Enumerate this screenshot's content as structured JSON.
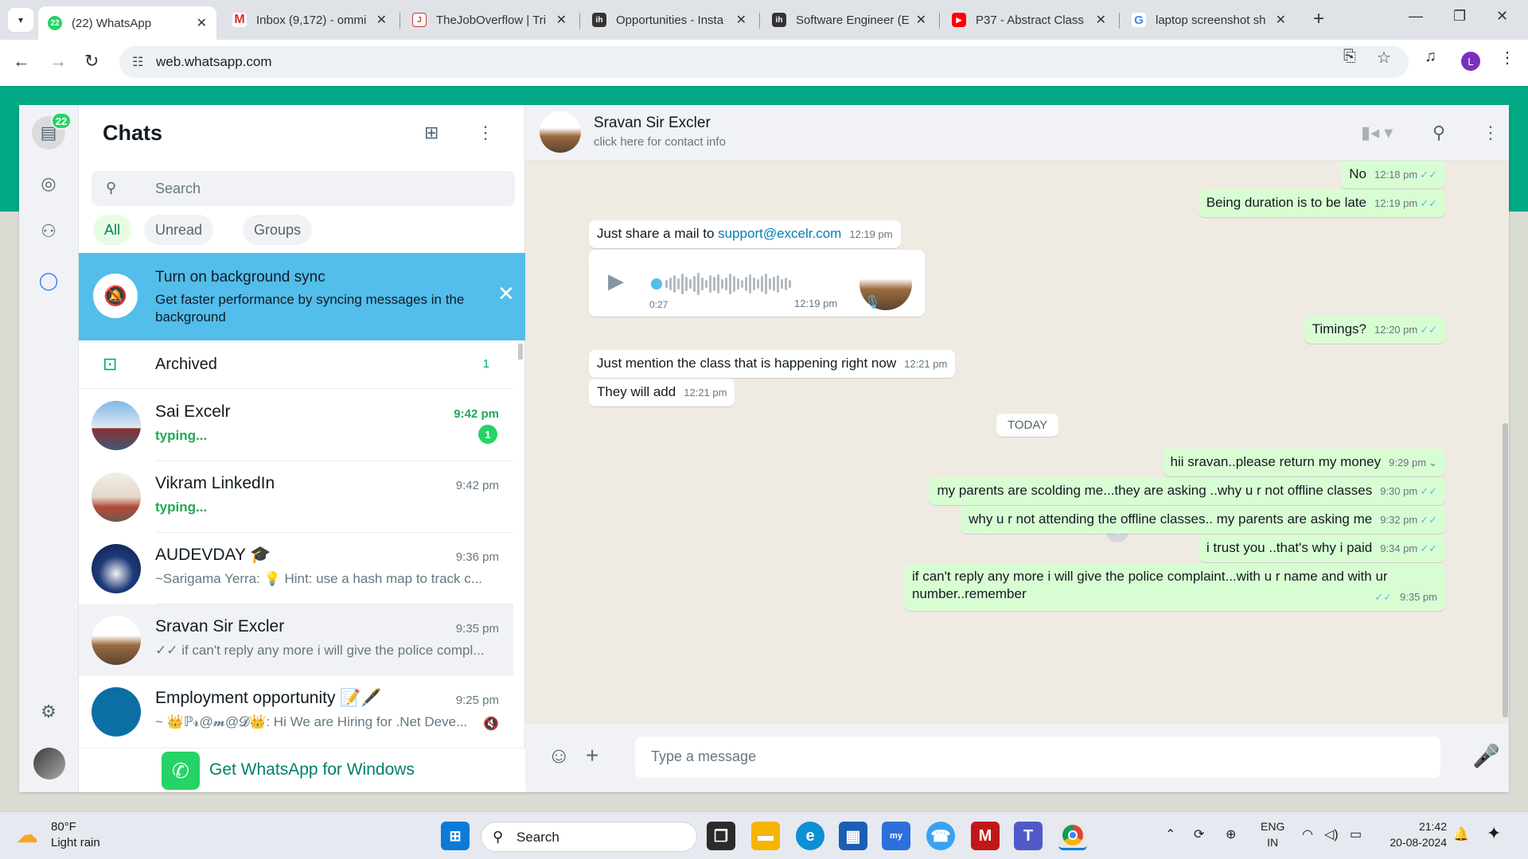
{
  "browser": {
    "tabs": [
      {
        "title": "(22) WhatsApp",
        "favicon": "whatsapp-icon",
        "active": true
      },
      {
        "title": "Inbox (9,172) - ommi",
        "favicon": "gmail-icon"
      },
      {
        "title": "TheJobOverflow | Tri",
        "favicon": "jobs-icon"
      },
      {
        "title": "Opportunities - Insta",
        "favicon": "ih-icon"
      },
      {
        "title": "Software Engineer (E",
        "favicon": "ih-icon"
      },
      {
        "title": "P37 - Abstract Class",
        "favicon": "youtube-icon"
      },
      {
        "title": "laptop screenshot sh",
        "favicon": "google-icon"
      }
    ],
    "url": "web.whatsapp.com",
    "profile_initial": "L"
  },
  "rail": {
    "chats_badge": "22"
  },
  "sidebar": {
    "title": "Chats",
    "search_placeholder": "Search",
    "filters": [
      "All",
      "Unread",
      "Groups"
    ],
    "banner": {
      "title": "Turn on background sync",
      "subtitle": "Get faster performance by syncing messages in the background"
    },
    "archived": {
      "label": "Archived",
      "count": "1"
    },
    "chats": [
      {
        "name": "Sai Excelr",
        "time": "9:42 pm",
        "preview": "typing...",
        "unread": "1"
      },
      {
        "name": "Vikram LinkedIn",
        "time": "9:42 pm",
        "preview": "typing..."
      },
      {
        "name": "AUDEVDAY 🎓",
        "time": "9:36 pm",
        "preview": "~Sarigama Yerra: 💡 Hint: use a hash map to track c..."
      },
      {
        "name": "Sravan Sir Excler",
        "time": "9:35 pm",
        "preview": "✓✓ if can't reply any more i will give the police compl..."
      },
      {
        "name": "Employment opportunity 📝🖋️",
        "time": "9:25 pm",
        "preview": "~ 👑ℙ𝓻@𝓶@𝓓👑: Hi We are Hiring for .Net Deve..."
      }
    ],
    "get_app": "Get WhatsApp for Windows"
  },
  "conversation": {
    "contact_name": "Sravan Sir Excler",
    "contact_sub": "click here for contact info",
    "day_label": "TODAY",
    "messages": [
      {
        "dir": "out",
        "text": "No",
        "time": "12:18 pm"
      },
      {
        "dir": "out",
        "text": "Being duration is to be late",
        "time": "12:19 pm"
      },
      {
        "dir": "in",
        "text": "Just share a mail to ",
        "link": "support@excelr.com",
        "time": "12:19 pm"
      },
      {
        "dir": "in",
        "voice_duration": "0:27",
        "time": "12:19 pm"
      },
      {
        "dir": "out",
        "text": "Timings?",
        "time": "12:20 pm"
      },
      {
        "dir": "in",
        "text": "Just mention the class that is happening right now",
        "time": "12:21 pm"
      },
      {
        "dir": "in",
        "text": "They will add",
        "time": "12:21 pm"
      },
      {
        "dir": "out",
        "text": "hii sravan..please return my money",
        "time": "9:29 pm"
      },
      {
        "dir": "out",
        "text": "my parents are scolding me...they are asking ..why u r not offline classes",
        "time": "9:30 pm"
      },
      {
        "dir": "out",
        "text": "why u r not attending the offline classes.. my parents  are asking me",
        "time": "9:32 pm"
      },
      {
        "dir": "out",
        "text": "i trust you ..that's why i paid",
        "time": "9:34 pm"
      },
      {
        "dir": "out",
        "text": "if can't reply any more i will give the police complaint...with u r name and with ur number..remember",
        "time": "9:35 pm"
      }
    ],
    "input_placeholder": "Type a message"
  },
  "taskbar": {
    "temperature": "80°F",
    "weather": "Light rain",
    "search": "Search",
    "lang_1": "ENG",
    "lang_2": "IN",
    "time": "21:42",
    "date": "20-08-2024"
  }
}
